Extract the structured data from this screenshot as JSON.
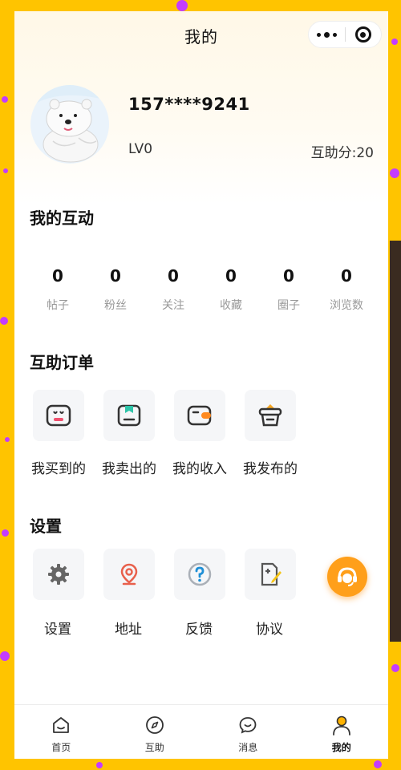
{
  "nav": {
    "title": "我的"
  },
  "profile": {
    "phone": "157****9241",
    "level": "LV0",
    "points": "互助分:20"
  },
  "interaction": {
    "title": "我的互动",
    "stats": [
      {
        "value": "0",
        "label": "帖子"
      },
      {
        "value": "0",
        "label": "粉丝"
      },
      {
        "value": "0",
        "label": "关注"
      },
      {
        "value": "0",
        "label": "收藏"
      },
      {
        "value": "0",
        "label": "圈子"
      },
      {
        "value": "0",
        "label": "浏览数"
      }
    ]
  },
  "orders": {
    "title": "互助订单",
    "items": [
      {
        "label": "我买到的",
        "icon": "bought-icon"
      },
      {
        "label": "我卖出的",
        "icon": "sold-icon"
      },
      {
        "label": "我的收入",
        "icon": "wallet-icon"
      },
      {
        "label": "我发布的",
        "icon": "basket-icon"
      }
    ]
  },
  "settings": {
    "title": "设置",
    "items": [
      {
        "label": "设置",
        "icon": "gear-icon"
      },
      {
        "label": "地址",
        "icon": "location-icon"
      },
      {
        "label": "反馈",
        "icon": "question-icon"
      },
      {
        "label": "协议",
        "icon": "document-edit-icon"
      }
    ]
  },
  "tabbar": {
    "items": [
      {
        "label": "首页",
        "icon": "home-icon",
        "active": false
      },
      {
        "label": "互助",
        "icon": "compass-icon",
        "active": false
      },
      {
        "label": "消息",
        "icon": "message-icon",
        "active": false
      },
      {
        "label": "我的",
        "icon": "user-icon",
        "active": true
      }
    ]
  },
  "colors": {
    "accent": "#ff9f1a",
    "border_bg": "#ffc400",
    "confetti": "#c43cff"
  }
}
